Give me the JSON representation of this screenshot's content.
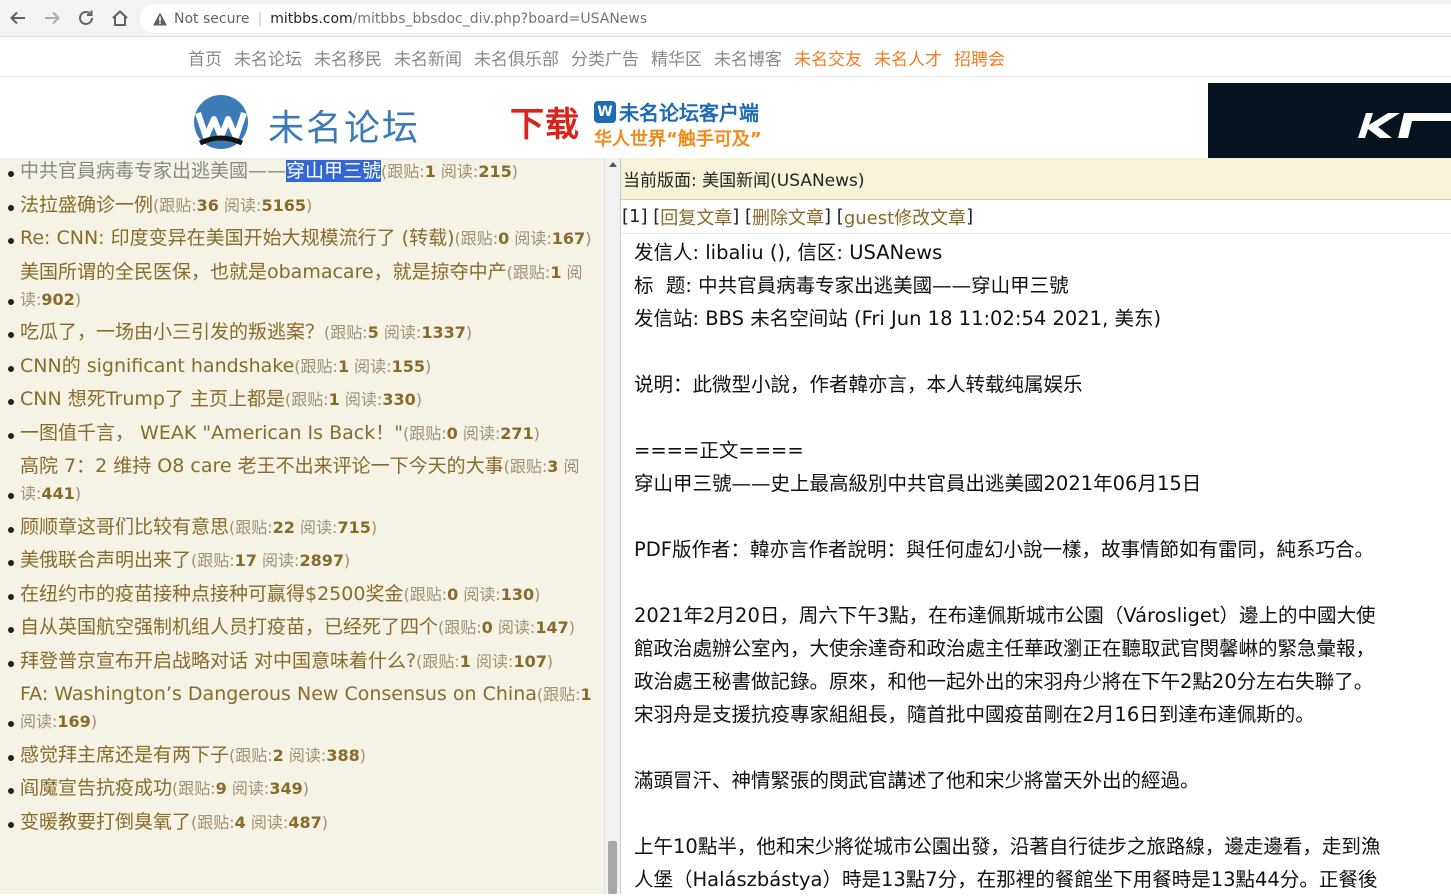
{
  "browser": {
    "security_label": "Not secure",
    "url_host": "mitbbs.com",
    "url_path": "/mitbbs_bbsdoc_div.php?board=USANews"
  },
  "sitenav": [
    {
      "label": "首页",
      "highlight": false
    },
    {
      "label": "未名论坛",
      "highlight": false
    },
    {
      "label": "未名移民",
      "highlight": false
    },
    {
      "label": "未名新闻",
      "highlight": false
    },
    {
      "label": "未名俱乐部",
      "highlight": false
    },
    {
      "label": "分类广告",
      "highlight": false
    },
    {
      "label": "精华区",
      "highlight": false
    },
    {
      "label": "未名博客",
      "highlight": false
    },
    {
      "label": "未名交友",
      "highlight": true
    },
    {
      "label": "未名人才",
      "highlight": true
    },
    {
      "label": "招聘会",
      "highlight": true
    }
  ],
  "banner": {
    "logo_text": "未名论坛",
    "download_text": "下载",
    "client_title": "未名论坛客户端",
    "client_slogan": "华人世界“触手可及”",
    "client_icon_letter": "W"
  },
  "list": [
    {
      "title_plain": "中共官員病毒专家出逃美國——",
      "title_selected": "穿山甲三號",
      "followups": "1",
      "reads": "215",
      "gray": true
    },
    {
      "title_plain": "法拉盛确诊一例",
      "followups": "36",
      "reads": "5165"
    },
    {
      "title_plain": "Re: CNN: 印度变异在美国开始大规模流行了 (转载)",
      "followups": "0",
      "reads": "167"
    },
    {
      "title_plain": "美国所谓的全民医保，也就是obamacare，就是掠夺中产",
      "followups": "1",
      "reads": "902"
    },
    {
      "title_plain": "吃瓜了，一场由小三引发的叛逃案？",
      "followups": "5",
      "reads": "1337"
    },
    {
      "title_plain": "CNN的 significant handshake",
      "followups": "1",
      "reads": "155"
    },
    {
      "title_plain": "CNN 想死Trump了 主页上都是",
      "followups": "1",
      "reads": "330"
    },
    {
      "title_plain": "一图值千言， WEAK \"American Is Back！\"",
      "followups": "0",
      "reads": "271"
    },
    {
      "title_plain": "高院 7：2 维持 O8 care 老王不出来评论一下今天的大事",
      "followups": "3",
      "reads": "441"
    },
    {
      "title_plain": "顾顺章这哥们比较有意思",
      "followups": "22",
      "reads": "715"
    },
    {
      "title_plain": "美俄联合声明出来了",
      "followups": "17",
      "reads": "2897"
    },
    {
      "title_plain": "在纽约市的疫苗接种点接种可赢得$2500奖金",
      "followups": "0",
      "reads": "130"
    },
    {
      "title_plain": "自从英国航空强制机组人员打疫苗，已经死了四个",
      "followups": "0",
      "reads": "147"
    },
    {
      "title_plain": "拜登普京宣布开启战略对话 对中国意味着什么?",
      "followups": "1",
      "reads": "107"
    },
    {
      "title_plain": "FA: Washington’s Dangerous New Consensus on China",
      "followups": "1",
      "reads": "169"
    },
    {
      "title_plain": "感觉拜主席还是有两下子",
      "followups": "2",
      "reads": "388"
    },
    {
      "title_plain": "阎魔宣告抗疫成功",
      "followups": "9",
      "reads": "349"
    },
    {
      "title_plain": "变暖教要打倒臭氧了",
      "followups": "4",
      "reads": "487"
    }
  ],
  "labels": {
    "followups": "跟贴:",
    "reads": "阅读:"
  },
  "board": {
    "current_label": "当前版面: 美国新闻(USANews)"
  },
  "actions": {
    "index": "[1]",
    "reply": "回复文章",
    "delete": "删除文章",
    "edit": "guest修改文章"
  },
  "article": {
    "lines": [
      "发信人: libaliu (), 信区: USANews",
      "标  题: 中共官員病毒专家出逃美國——穿山甲三號",
      "发信站: BBS 未名空间站 (Fri Jun 18 11:02:54 2021, 美东)",
      "",
      "说明：此微型小說，作者韓亦言，本人转载纯属娱乐",
      "",
      "====正文====",
      "穿山甲三號——史上最高級別中共官員出逃美國2021年06月15日",
      "",
      "PDF版作者：韓亦言作者說明：與任何虛幻小說一樣，故事情節如有雷同，純系巧合。",
      "",
      "2021年2月20日，周六下午3點，在布達佩斯城市公園（Városliget）邊上的中國大使",
      "館政治處辦公室內，大使余達奇和政治處主任華政瀏正在聽取武官閔馨崊的緊急彙報，",
      "政治處王秘書做記錄。原來，和他一起外出的宋羽舟少將在下午2點20分左右失聯了。",
      "宋羽舟是支援抗疫專家組組長，隨首批中國疫苗剛在2月16日到達布達佩斯的。",
      "",
      "滿頭冒汗、神情緊張的閔武官講述了他和宋少將當天外出的經過。",
      "",
      "上午10點半，他和宋少將從城市公園出發，沿著自行徒步之旅路線，邊走邊看，走到漁",
      "人堡（Halászbástya）時是13點7分，在那裡的餐館坐下用餐時是13點44分。正餐後"
    ]
  }
}
